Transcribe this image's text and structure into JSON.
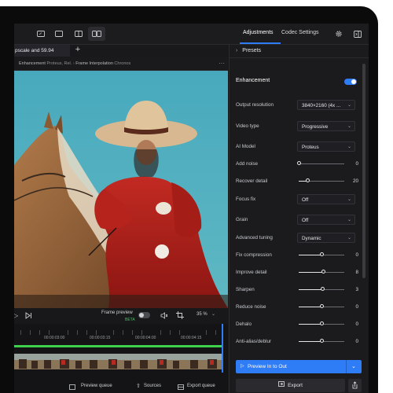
{
  "toolbar": {
    "icons": [
      "crop-view-icon",
      "single-view-icon",
      "split-view-icon",
      "side-by-side-icon",
      "gear-icon",
      "panel-toggle-icon"
    ]
  },
  "panel_tabs": [
    {
      "label": "Adjustments",
      "active": true
    },
    {
      "label": "Codec Settings",
      "active": false
    }
  ],
  "file_tab": {
    "label": "pscale and 59.94"
  },
  "breadcrumb": {
    "enh_label": "Enhancement",
    "enh_value": "Proteus, Rel.",
    "fi_label": "Frame Interpolation",
    "fi_value": "Chronos"
  },
  "panel": {
    "presets_label": "Presets",
    "enhancement_label": "Enhancement",
    "enhancement_enabled": true,
    "dropdowns": [
      {
        "label": "Output resolution",
        "value": "3840×2160 (4x ..."
      },
      {
        "label": "Video type",
        "value": "Progressive"
      },
      {
        "label": "AI Model",
        "value": "Proteus"
      },
      {
        "label": "Focus fix",
        "value": "Off"
      },
      {
        "label": "Grain",
        "value": "Off"
      },
      {
        "label": "Advanced tuning",
        "value": "Dynamic"
      }
    ],
    "sliders": [
      {
        "label": "Add noise",
        "value": "0",
        "level": 0.0
      },
      {
        "label": "Recover detail",
        "value": "20",
        "level": 0.2
      },
      {
        "label": "Fix compression",
        "value": "0",
        "level": 0.5
      },
      {
        "label": "Improve detail",
        "value": "8",
        "level": 0.54
      },
      {
        "label": "Sharpen",
        "value": "3",
        "level": 0.52
      },
      {
        "label": "Reduce noise",
        "value": "0",
        "level": 0.5
      },
      {
        "label": "Dehalo",
        "value": "0",
        "level": 0.5
      },
      {
        "label": "Anti-alias/deblur",
        "value": "0",
        "level": 0.5
      }
    ],
    "preview_button": "Preview In to Out",
    "export_button": "Export"
  },
  "preview_bar": {
    "label": "Frame preview",
    "badge": "BETA",
    "zoom": "35 %"
  },
  "timeline": {
    "timecodes": [
      "00:00:03:00",
      "00:00:03:15",
      "00:00:04:00",
      "00:00:04:15"
    ]
  },
  "bottom_bar": {
    "preview_queue": "Preview queue",
    "sources": "Sources",
    "export_queue": "Export queue"
  },
  "colors": {
    "accent": "#2f7df6",
    "timeline_green": "#3fd14c",
    "beta_green": "#37c85a"
  }
}
